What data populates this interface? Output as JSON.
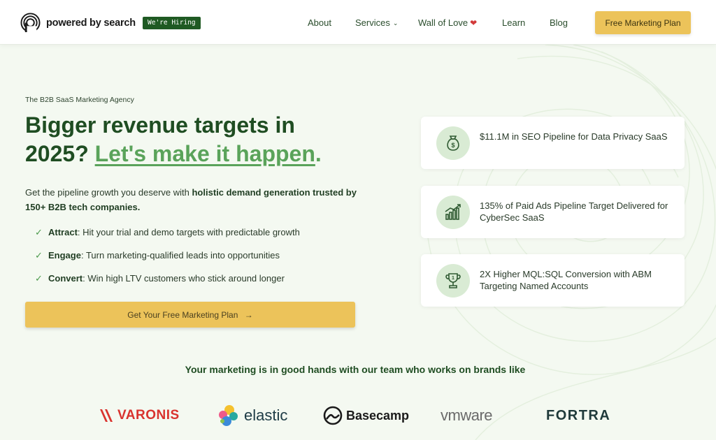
{
  "header": {
    "logo_text": "powered by search",
    "hiring_badge": "We're Hiring",
    "nav": [
      {
        "label": "About"
      },
      {
        "label": "Services"
      },
      {
        "label": "Wall of Love"
      },
      {
        "label": "Learn"
      },
      {
        "label": "Blog"
      }
    ],
    "cta_label": "Free Marketing Plan"
  },
  "hero": {
    "eyebrow": "The B2B SaaS Marketing Agency",
    "headline_start": "Bigger revenue targets in 2025?",
    "headline_highlight": "Let's make it happen",
    "headline_end": ".",
    "lead_plain": "Get the pipeline growth you deserve with",
    "lead_bold": "holistic demand generation trusted by 150+ B2B tech companies.",
    "bullets": [
      {
        "title": "Attract",
        "text": ": Hit your trial and demo targets with predictable growth"
      },
      {
        "title": "Engage",
        "text": ": Turn marketing-qualified leads into opportunities"
      },
      {
        "title": "Convert",
        "text": ": Win high LTV customers who stick around longer"
      }
    ],
    "cta_label": "Get Your Free Marketing Plan",
    "cta_arrow": "→"
  },
  "results": [
    {
      "icon": "money-bag-icon",
      "text": "$11.1M in SEO Pipeline for Data Privacy SaaS"
    },
    {
      "icon": "bar-chart-growth-icon",
      "text": "135% of Paid Ads Pipeline Target Delivered for CyberSec SaaS"
    },
    {
      "icon": "trophy-icon",
      "text": "2X Higher MQL:SQL Conversion with ABM Targeting Named Accounts"
    }
  ],
  "brands": {
    "title": "Your marketing is in good hands with our team who works on brands like",
    "logos": [
      "VARONIS",
      "elastic",
      "Basecamp",
      "vmware",
      "FORTRA"
    ]
  },
  "colors": {
    "brand_green": "#1f4d22",
    "accent_green": "#5aa35a",
    "cta_yellow": "#ecc35a",
    "background": "#f4f9f1"
  }
}
